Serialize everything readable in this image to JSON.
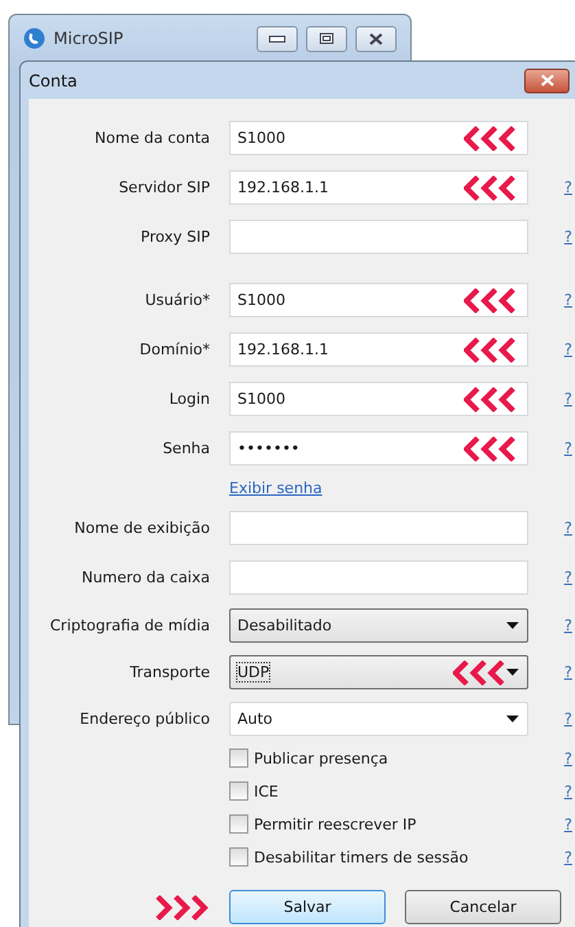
{
  "background_window": {
    "title": "MicroSIP"
  },
  "dialog": {
    "title": "Conta"
  },
  "sections": [
    {
      "rows": [
        {
          "kind": "text",
          "label": "Nome da conta",
          "value": "S1000",
          "marked": true
        },
        {
          "kind": "text",
          "label": "Servidor SIP",
          "value": "192.168.1.1",
          "marked": true,
          "help": "?"
        },
        {
          "kind": "text",
          "label": "Proxy SIP",
          "marked": false,
          "help": "?"
        }
      ]
    },
    {
      "rows": [
        {
          "kind": "text",
          "label": "Usuário*",
          "value": "S1000",
          "marked": true,
          "help": "?"
        },
        {
          "kind": "text",
          "label": "Domínio*",
          "value": "192.168.1.1",
          "marked": true,
          "help": "?"
        },
        {
          "kind": "text",
          "label": "Login",
          "value": "S1000",
          "marked": true,
          "help": "?"
        },
        {
          "kind": "text",
          "label": "Senha",
          "value": "•••••••",
          "marked": true,
          "help": "?"
        },
        {
          "kind": "link",
          "label": "Exibir senha"
        },
        {
          "kind": "text",
          "label": "Nome de exibição",
          "marked": false,
          "help": "?"
        },
        {
          "kind": "text",
          "label": "Numero da caixa",
          "marked": false,
          "help": "?"
        },
        {
          "kind": "select",
          "label": "Criptografia de mídia",
          "value": "Desabilitado",
          "focused": false,
          "marked": false,
          "help": "?"
        },
        {
          "kind": "select",
          "label": "Transporte",
          "value": "UDP",
          "focused": true,
          "marked": true,
          "help": "?"
        },
        {
          "kind": "combo",
          "label": "Endereço público",
          "value": "Auto",
          "marked": false,
          "help": "?"
        },
        {
          "kind": "checkbox",
          "label": "Publicar presença",
          "checked": false,
          "help": "?"
        },
        {
          "kind": "checkbox",
          "label": "ICE",
          "checked": false,
          "help": "?"
        },
        {
          "kind": "checkbox",
          "label": "Permitir reescrever IP",
          "checked": false,
          "help": "?"
        },
        {
          "kind": "checkbox",
          "label": "Desabilitar timers de sessão",
          "checked": false,
          "help": "?"
        }
      ]
    }
  ],
  "buttons": [
    {
      "label": "Salvar",
      "default": true,
      "marked": true
    },
    {
      "label": "Cancelar",
      "default": false,
      "marked": false
    }
  ]
}
